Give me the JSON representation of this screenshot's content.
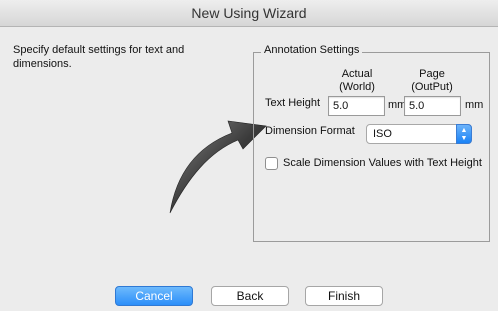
{
  "window": {
    "title": "New Using Wizard"
  },
  "intro": "Specify default settings for text and dimensions.",
  "annotation_settings": {
    "legend": "Annotation Settings",
    "column_actual": "Actual\n(World)",
    "column_page": "Page\n(OutPut)",
    "text_height_label": "Text Height",
    "actual_value": "5.0",
    "actual_unit": "mm",
    "page_value": "5.0",
    "page_unit": "mm",
    "dimension_format_label": "Dimension Format",
    "dimension_format_value": "ISO",
    "scale_checkbox_label": "Scale Dimension Values with Text Height",
    "scale_checkbox_checked": false
  },
  "buttons": {
    "cancel": "Cancel",
    "back": "Back",
    "finish": "Finish"
  },
  "colors": {
    "accent": "#2b8ef9",
    "arrow": "#3a3a3a"
  },
  "icons": {
    "pointer": "curved-arrow-icon",
    "stepper": "up-down-chevron-icon"
  }
}
